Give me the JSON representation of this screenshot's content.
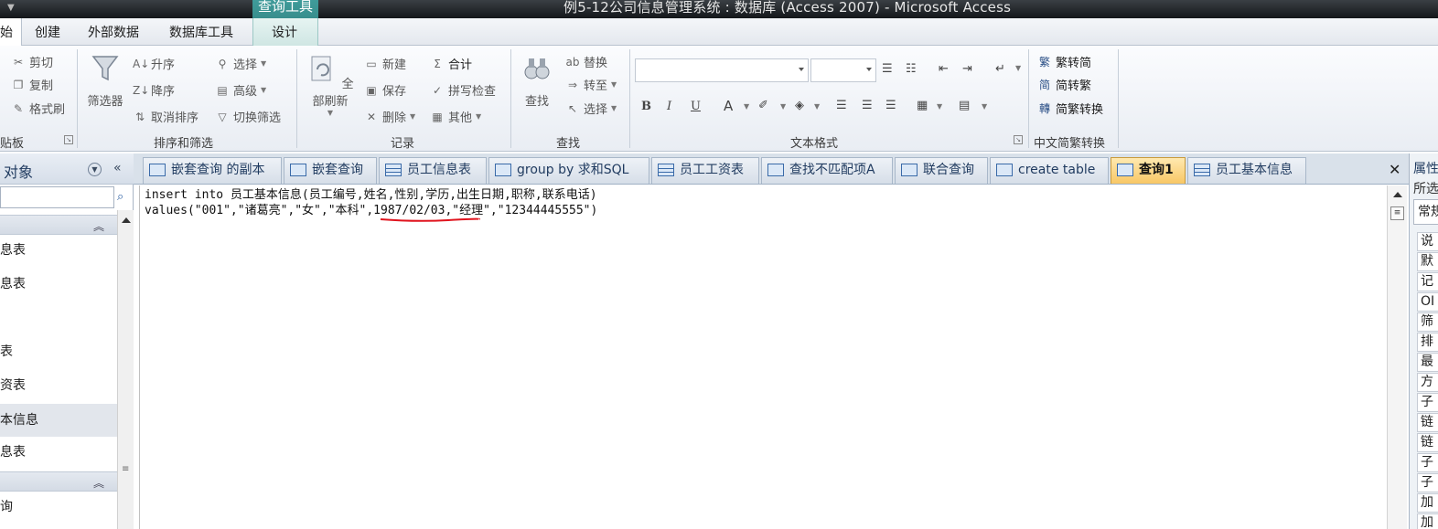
{
  "window": {
    "title": "例5-12公司信息管理系统 : 数据库 (Access 2007) - Microsoft Access",
    "context_tab_group": "查询工具"
  },
  "ribbon_tabs": [
    "始",
    "创建",
    "外部数据",
    "数据库工具",
    "设计"
  ],
  "ribbon": {
    "clipboard": {
      "label": "贴板",
      "cut": "剪切",
      "copy": "复制",
      "format_painter": "格式刷"
    },
    "sort_filter": {
      "label": "排序和筛选",
      "filter": "筛选器",
      "ascending": "升序",
      "descending": "降序",
      "clear_sort": "取消排序",
      "selection": "选择",
      "advanced": "高级",
      "toggle_filter": "切换筛选"
    },
    "records": {
      "label": "记录",
      "refresh_all": "全部刷新",
      "new": "新建",
      "save": "保存",
      "delete": "删除",
      "totals": "合计",
      "spelling": "拼写检查",
      "more": "其他"
    },
    "find": {
      "label": "查找",
      "find": "查找",
      "replace": "替换",
      "goto": "转至",
      "select": "选择"
    },
    "text_format": {
      "label": "文本格式",
      "bold": "B",
      "italic": "I",
      "underline": "U",
      "font_color": "A"
    },
    "chinese_conversion": {
      "label": "中文简繁转换",
      "to_simplified": "繁转简",
      "to_traditional": "简转繁",
      "convert": "简繁转换"
    }
  },
  "nav_pane": {
    "title": "对象",
    "items": [
      "息表",
      "息表",
      "",
      "表",
      "资表",
      "本信息",
      "息表"
    ],
    "last_item": "询"
  },
  "doc_tabs": [
    {
      "label": "嵌套查询 的副本",
      "icon": "query-icon"
    },
    {
      "label": "嵌套查询",
      "icon": "query-icon"
    },
    {
      "label": "员工信息表",
      "icon": "table-icon"
    },
    {
      "label": "group by 求和SQL",
      "icon": "query-icon"
    },
    {
      "label": "员工工资表",
      "icon": "table-icon"
    },
    {
      "label": "查找不匹配项A",
      "icon": "query-icon"
    },
    {
      "label": "联合查询",
      "icon": "query-icon"
    },
    {
      "label": "create table",
      "icon": "query-icon"
    },
    {
      "label": "查询1",
      "icon": "query-icon",
      "active": true
    },
    {
      "label": "员工基本信息",
      "icon": "table-icon"
    }
  ],
  "editor": {
    "line1": "insert into 员工基本信息(员工编号,姓名,性别,学历,出生日期,职称,联系电话)",
    "line2": "values(\"001\",\"诸葛亮\",\"女\",\"本科\",1987/02/03,\"经理\",\"12344445555\")",
    "annotation_color": "#e0141e"
  },
  "property_sheet": {
    "title": "属性",
    "subtitle": "所选",
    "tab": "常规",
    "rows": [
      "说",
      "默",
      "记",
      "OI",
      "筛",
      "排",
      "最",
      "方",
      "子",
      "链",
      "链",
      "子",
      "子",
      "加",
      "加"
    ]
  }
}
